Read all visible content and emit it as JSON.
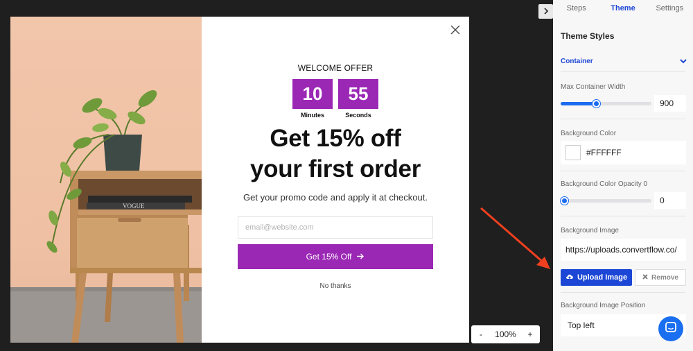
{
  "popup": {
    "offer_label": "WELCOME OFFER",
    "timer": [
      {
        "value": "10",
        "label": "Minutes"
      },
      {
        "value": "55",
        "label": "Seconds"
      }
    ],
    "headline_line1": "Get 15% off",
    "headline_line2": "your first order",
    "subtext": "Get your promo code and apply it at checkout.",
    "email_placeholder": "email@website.com",
    "cta_label": "Get 15% Off",
    "no_thanks": "No thanks",
    "accent_color": "#9b27b5"
  },
  "zoom": {
    "minus": "-",
    "level": "100%",
    "plus": "+"
  },
  "sidebar": {
    "tabs": [
      "Steps",
      "Theme",
      "Settings"
    ],
    "active_tab": "Theme",
    "section_title": "Theme Styles",
    "container_label": "Container",
    "max_width": {
      "label": "Max Container Width",
      "value": "900",
      "slider_fraction": 0.4
    },
    "bg_color": {
      "label": "Background Color",
      "value": "#FFFFFF"
    },
    "bg_opacity": {
      "label": "Background Color Opacity 0",
      "value": "0",
      "slider_fraction": 0.0
    },
    "bg_image": {
      "label": "Background Image",
      "value": "https://uploads.convertflow.co/",
      "upload_label": "Upload Image",
      "remove_label": "Remove"
    },
    "bg_position": {
      "label": "Background Image Position",
      "value": "Top left"
    },
    "accent_color": "#1c47d6"
  }
}
